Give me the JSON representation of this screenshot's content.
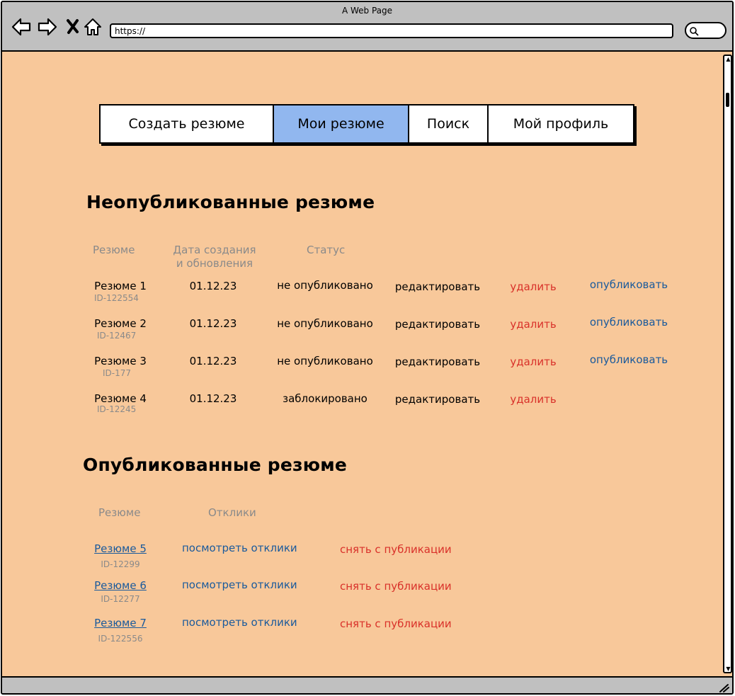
{
  "window": {
    "title": "A Web Page",
    "url": "https://"
  },
  "tabs": [
    {
      "label": "Создать резюме",
      "active": false
    },
    {
      "label": "Мои резюме",
      "active": true
    },
    {
      "label": "Поиск",
      "active": false
    },
    {
      "label": "Мой профиль",
      "active": false
    }
  ],
  "unpublished": {
    "title": "Неопубликованные резюме",
    "headers": {
      "resume": "Резюме",
      "dates_line1": "Дата создания",
      "dates_line2": "и обновления",
      "status": "Статус"
    },
    "rows": [
      {
        "name": "Резюме 1",
        "id": "ID-122554",
        "date": "01.12.23",
        "status": "не опубликовано",
        "edit": "редактировать",
        "delete": "удалить",
        "publish": "опубликовать"
      },
      {
        "name": "Резюме 2",
        "id": "ID-12467",
        "date": "01.12.23",
        "status": "не опубликовано",
        "edit": "редактировать",
        "delete": "удалить",
        "publish": "опубликовать"
      },
      {
        "name": "Резюме 3",
        "id": "ID-177",
        "date": "01.12.23",
        "status": "не опубликовано",
        "edit": "редактировать",
        "delete": "удалить",
        "publish": "опубликовать"
      },
      {
        "name": "Резюме 4",
        "id": "ID-12245",
        "date": "01.12.23",
        "status": "заблокировано",
        "edit": "редактировать",
        "delete": "удалить",
        "publish": ""
      }
    ]
  },
  "published": {
    "title": "Опубликованные резюме",
    "headers": {
      "resume": "Резюме",
      "responses": "Отклики"
    },
    "rows": [
      {
        "name": "Резюме 5",
        "id": "ID-12299",
        "responses": "посмотреть отклики",
        "unpublish": "снять с публикации"
      },
      {
        "name": "Резюме 6",
        "id": "ID-12277",
        "responses": "посмотреть отклики",
        "unpublish": "снять с публикации"
      },
      {
        "name": "Резюме 7",
        "id": "ID-122556",
        "responses": "посмотреть отклики",
        "unpublish": "снять с публикации"
      }
    ]
  },
  "colors": {
    "page_background": "#f8c89a",
    "active_tab": "#91b7ef",
    "link_blue": "#1a5a9c",
    "link_red": "#d9312a",
    "muted_text": "#8a8a8a",
    "chrome": "#c0c0c0"
  },
  "icons": [
    "back-arrow-icon",
    "forward-arrow-icon",
    "close-icon",
    "home-icon",
    "search-icon",
    "resize-grip-icon",
    "scroll-up-icon",
    "scroll-down-icon"
  ]
}
